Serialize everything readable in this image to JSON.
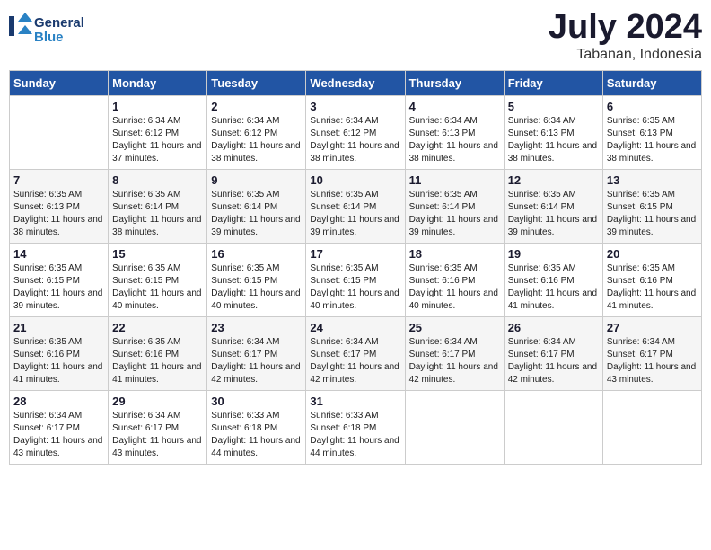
{
  "header": {
    "logo_line1": "General",
    "logo_line2": "Blue",
    "month_title": "July 2024",
    "location": "Tabanan, Indonesia"
  },
  "weekdays": [
    "Sunday",
    "Monday",
    "Tuesday",
    "Wednesday",
    "Thursday",
    "Friday",
    "Saturday"
  ],
  "weeks": [
    [
      {
        "day": "",
        "sunrise": "",
        "sunset": "",
        "daylight": ""
      },
      {
        "day": "1",
        "sunrise": "Sunrise: 6:34 AM",
        "sunset": "Sunset: 6:12 PM",
        "daylight": "Daylight: 11 hours and 37 minutes."
      },
      {
        "day": "2",
        "sunrise": "Sunrise: 6:34 AM",
        "sunset": "Sunset: 6:12 PM",
        "daylight": "Daylight: 11 hours and 38 minutes."
      },
      {
        "day": "3",
        "sunrise": "Sunrise: 6:34 AM",
        "sunset": "Sunset: 6:12 PM",
        "daylight": "Daylight: 11 hours and 38 minutes."
      },
      {
        "day": "4",
        "sunrise": "Sunrise: 6:34 AM",
        "sunset": "Sunset: 6:13 PM",
        "daylight": "Daylight: 11 hours and 38 minutes."
      },
      {
        "day": "5",
        "sunrise": "Sunrise: 6:34 AM",
        "sunset": "Sunset: 6:13 PM",
        "daylight": "Daylight: 11 hours and 38 minutes."
      },
      {
        "day": "6",
        "sunrise": "Sunrise: 6:35 AM",
        "sunset": "Sunset: 6:13 PM",
        "daylight": "Daylight: 11 hours and 38 minutes."
      }
    ],
    [
      {
        "day": "7",
        "sunrise": "Sunrise: 6:35 AM",
        "sunset": "Sunset: 6:13 PM",
        "daylight": "Daylight: 11 hours and 38 minutes."
      },
      {
        "day": "8",
        "sunrise": "Sunrise: 6:35 AM",
        "sunset": "Sunset: 6:14 PM",
        "daylight": "Daylight: 11 hours and 38 minutes."
      },
      {
        "day": "9",
        "sunrise": "Sunrise: 6:35 AM",
        "sunset": "Sunset: 6:14 PM",
        "daylight": "Daylight: 11 hours and 39 minutes."
      },
      {
        "day": "10",
        "sunrise": "Sunrise: 6:35 AM",
        "sunset": "Sunset: 6:14 PM",
        "daylight": "Daylight: 11 hours and 39 minutes."
      },
      {
        "day": "11",
        "sunrise": "Sunrise: 6:35 AM",
        "sunset": "Sunset: 6:14 PM",
        "daylight": "Daylight: 11 hours and 39 minutes."
      },
      {
        "day": "12",
        "sunrise": "Sunrise: 6:35 AM",
        "sunset": "Sunset: 6:14 PM",
        "daylight": "Daylight: 11 hours and 39 minutes."
      },
      {
        "day": "13",
        "sunrise": "Sunrise: 6:35 AM",
        "sunset": "Sunset: 6:15 PM",
        "daylight": "Daylight: 11 hours and 39 minutes."
      }
    ],
    [
      {
        "day": "14",
        "sunrise": "Sunrise: 6:35 AM",
        "sunset": "Sunset: 6:15 PM",
        "daylight": "Daylight: 11 hours and 39 minutes."
      },
      {
        "day": "15",
        "sunrise": "Sunrise: 6:35 AM",
        "sunset": "Sunset: 6:15 PM",
        "daylight": "Daylight: 11 hours and 40 minutes."
      },
      {
        "day": "16",
        "sunrise": "Sunrise: 6:35 AM",
        "sunset": "Sunset: 6:15 PM",
        "daylight": "Daylight: 11 hours and 40 minutes."
      },
      {
        "day": "17",
        "sunrise": "Sunrise: 6:35 AM",
        "sunset": "Sunset: 6:15 PM",
        "daylight": "Daylight: 11 hours and 40 minutes."
      },
      {
        "day": "18",
        "sunrise": "Sunrise: 6:35 AM",
        "sunset": "Sunset: 6:16 PM",
        "daylight": "Daylight: 11 hours and 40 minutes."
      },
      {
        "day": "19",
        "sunrise": "Sunrise: 6:35 AM",
        "sunset": "Sunset: 6:16 PM",
        "daylight": "Daylight: 11 hours and 41 minutes."
      },
      {
        "day": "20",
        "sunrise": "Sunrise: 6:35 AM",
        "sunset": "Sunset: 6:16 PM",
        "daylight": "Daylight: 11 hours and 41 minutes."
      }
    ],
    [
      {
        "day": "21",
        "sunrise": "Sunrise: 6:35 AM",
        "sunset": "Sunset: 6:16 PM",
        "daylight": "Daylight: 11 hours and 41 minutes."
      },
      {
        "day": "22",
        "sunrise": "Sunrise: 6:35 AM",
        "sunset": "Sunset: 6:16 PM",
        "daylight": "Daylight: 11 hours and 41 minutes."
      },
      {
        "day": "23",
        "sunrise": "Sunrise: 6:34 AM",
        "sunset": "Sunset: 6:17 PM",
        "daylight": "Daylight: 11 hours and 42 minutes."
      },
      {
        "day": "24",
        "sunrise": "Sunrise: 6:34 AM",
        "sunset": "Sunset: 6:17 PM",
        "daylight": "Daylight: 11 hours and 42 minutes."
      },
      {
        "day": "25",
        "sunrise": "Sunrise: 6:34 AM",
        "sunset": "Sunset: 6:17 PM",
        "daylight": "Daylight: 11 hours and 42 minutes."
      },
      {
        "day": "26",
        "sunrise": "Sunrise: 6:34 AM",
        "sunset": "Sunset: 6:17 PM",
        "daylight": "Daylight: 11 hours and 42 minutes."
      },
      {
        "day": "27",
        "sunrise": "Sunrise: 6:34 AM",
        "sunset": "Sunset: 6:17 PM",
        "daylight": "Daylight: 11 hours and 43 minutes."
      }
    ],
    [
      {
        "day": "28",
        "sunrise": "Sunrise: 6:34 AM",
        "sunset": "Sunset: 6:17 PM",
        "daylight": "Daylight: 11 hours and 43 minutes."
      },
      {
        "day": "29",
        "sunrise": "Sunrise: 6:34 AM",
        "sunset": "Sunset: 6:17 PM",
        "daylight": "Daylight: 11 hours and 43 minutes."
      },
      {
        "day": "30",
        "sunrise": "Sunrise: 6:33 AM",
        "sunset": "Sunset: 6:18 PM",
        "daylight": "Daylight: 11 hours and 44 minutes."
      },
      {
        "day": "31",
        "sunrise": "Sunrise: 6:33 AM",
        "sunset": "Sunset: 6:18 PM",
        "daylight": "Daylight: 11 hours and 44 minutes."
      },
      {
        "day": "",
        "sunrise": "",
        "sunset": "",
        "daylight": ""
      },
      {
        "day": "",
        "sunrise": "",
        "sunset": "",
        "daylight": ""
      },
      {
        "day": "",
        "sunrise": "",
        "sunset": "",
        "daylight": ""
      }
    ]
  ]
}
